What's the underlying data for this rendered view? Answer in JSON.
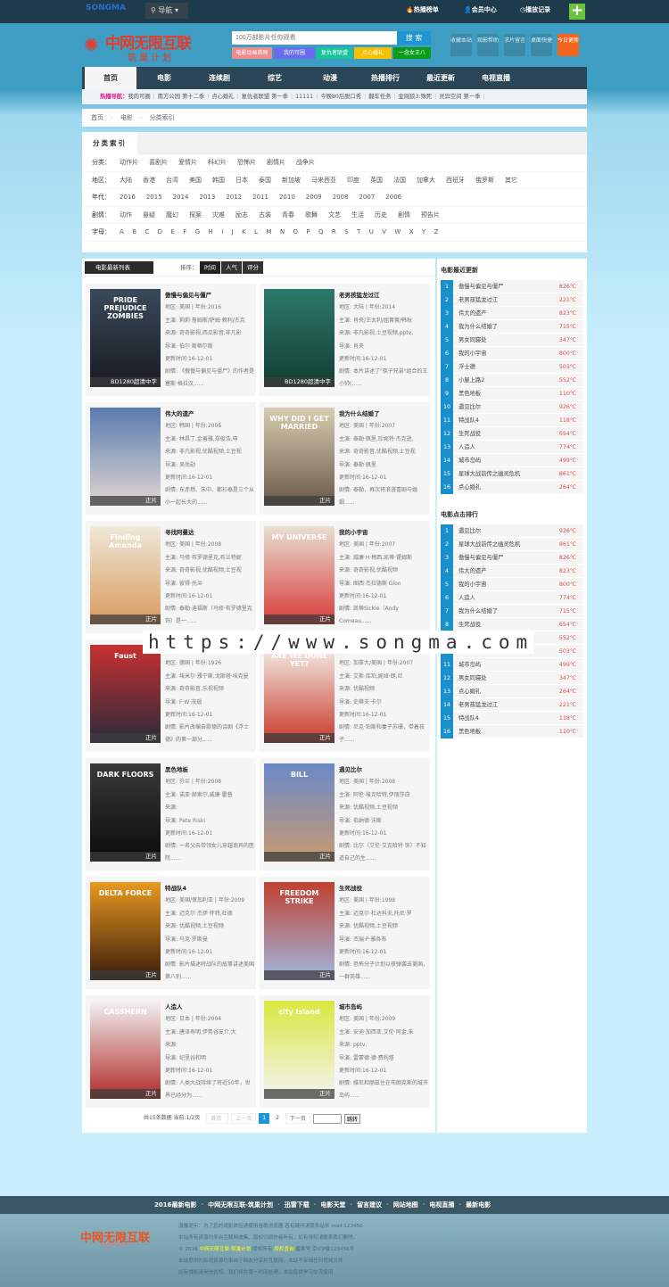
{
  "topbar": {
    "logo": "SONGMA",
    "nav": "导航",
    "links": [
      "热播榜单",
      "会员中心",
      "播放记录"
    ],
    "plus": "+"
  },
  "header": {
    "logo": "中网无限互联",
    "slogan": "筑巢计划",
    "search_placeholder": "100万部影片任你观看",
    "search_button": "搜 索",
    "tags": [
      {
        "label": "电影动画首映",
        "color": "#f08c8c"
      },
      {
        "label": "我的可圈",
        "color": "#6a6af0"
      },
      {
        "label": "复仇者联盟",
        "color": "#17c39a"
      },
      {
        "label": "点心婚礼",
        "color": "#f5c000"
      },
      {
        "label": "一念女王八",
        "color": "#0a9c1a"
      }
    ],
    "quick": [
      "收藏本站",
      "观影帮助",
      "求片留言",
      "桌面快捷",
      "今日更新"
    ]
  },
  "nav": {
    "items": [
      "首页",
      "电影",
      "连续剧",
      "综艺",
      "动漫",
      "热播排行",
      "最近更新",
      "电视直播"
    ],
    "active": 0
  },
  "hotnav": {
    "label": "热播导航：",
    "items": [
      "我的可圈",
      "南方公园 第十二季",
      "点心婚礼",
      "复仇者联盟 第一季",
      "11111",
      "今晚80后脱口秀",
      "翻车任务",
      "金刚狼3:殊死",
      "灵异空间 第一季"
    ]
  },
  "breadcrumb": [
    "首页",
    "电影",
    "分类索引"
  ],
  "filter": {
    "title": "分类索引",
    "rows": [
      {
        "label": "分类：",
        "items": [
          "动作片",
          "喜剧片",
          "爱情片",
          "科幻片",
          "恐怖片",
          "剧情片",
          "战争片"
        ]
      },
      {
        "label": "地区：",
        "items": [
          "大陆",
          "香港",
          "台湾",
          "美国",
          "韩国",
          "日本",
          "泰国",
          "新加坡",
          "马来西亚",
          "印度",
          "英国",
          "法国",
          "加拿大",
          "西班牙",
          "俄罗斯",
          "其它"
        ]
      },
      {
        "label": "年代：",
        "items": [
          "2016",
          "2015",
          "2014",
          "2013",
          "2012",
          "2011",
          "2010",
          "2009",
          "2008",
          "2007",
          "2006"
        ]
      },
      {
        "label": "剧情：",
        "items": [
          "动作",
          "悬疑",
          "魔幻",
          "探案",
          "灾难",
          "励志",
          "古装",
          "青春",
          "歌舞",
          "文艺",
          "生活",
          "历史",
          "剧情",
          "预告片"
        ]
      },
      {
        "label": "字母：",
        "items": [
          "A",
          "B",
          "C",
          "D",
          "E",
          "F",
          "G",
          "H",
          "I",
          "J",
          "K",
          "L",
          "M",
          "N",
          "O",
          "P",
          "Q",
          "R",
          "S",
          "T",
          "U",
          "V",
          "W",
          "X",
          "Y",
          "Z"
        ]
      }
    ]
  },
  "list": {
    "title": "电影最新列表",
    "sort_label": "排序：",
    "sorts": [
      "时间",
      "人气",
      "评分"
    ],
    "labels": {
      "region": "地区: ",
      "year": "年份:",
      "actors": "主演: ",
      "source": "来源: ",
      "director": "导演: ",
      "updated": "更新时间:",
      "desc": "剧情: "
    },
    "movies": [
      {
        "title": "傲慢与偏见与僵尸",
        "region": "美国",
        "year": "2016",
        "actors": "莉莉·詹姆斯/萨姆·赖利/杰克",
        "source": "奇奇影视,西瓜影音,非凡影",
        "director": "伯尔·斯蒂尔斯",
        "updated": "16-12-01",
        "desc": "《傲慢与偏见与僵尸》的作者是塞斯·格拉汉......",
        "badge": "BD1280超清中字",
        "poster": "PRIDE PREJUDICE ZOMBIES",
        "c1": "#3a4a5a",
        "c2": "#1a1a22"
      },
      {
        "title": "老男孩猛龙过江",
        "region": "大陆",
        "year": "2014",
        "actors": "肖央/王太利/屈菁菁/韩秋",
        "source": "非凡影视,土豆视频,pptv,",
        "director": "肖央",
        "updated": "16-12-01",
        "desc": "本片讲述了\"筷子兄弟\"组合的王小帅(......",
        "badge": "BD1280超清中字",
        "poster": "",
        "c1": "#2b7a6a",
        "c2": "#143c30"
      },
      {
        "title": "伟大的遗产",
        "region": "韩国",
        "year": "2006",
        "actors": "林昌丁,金善雅,郑俊浩,申",
        "source": "非凡影视,优酷视频,土豆视",
        "director": "吴尚勋",
        "updated": "16-12-01",
        "desc": "东赤燃、朱中、都衫泰是三个从小一起长大的......",
        "badge": "正片",
        "poster": "",
        "c1": "#5a7ab0",
        "c2": "#e0d8d0"
      },
      {
        "title": "我为什么结婚了",
        "region": "美国",
        "year": "2007",
        "actors": "泰勒·佩里,珍妮特·杰克逊,",
        "source": "奇奇影音,优酷视频,土豆视",
        "director": "泰勒·佩里",
        "updated": "16-12-01",
        "desc": "泰勒，再次将浪漫喜剧与婚姻......",
        "badge": "正片",
        "poster": "WHY DID I GET MARRIED",
        "c1": "#d8ccb0",
        "c2": "#6a5a48"
      },
      {
        "title": "寻找阿曼达",
        "region": "美国",
        "year": "2008",
        "actors": "马修·布罗德里克,布兰特妮",
        "source": "奇奇影视,优酷视频,土豆视",
        "director": "彼得·托兰",
        "updated": "16-12-01",
        "desc": "泰勒·迪福斯（马修·布罗德里克 饰）是一......",
        "badge": "正片",
        "poster": "Finding Amanda",
        "c1": "#f0e8d8",
        "c2": "#d89a60"
      },
      {
        "title": "我的小宇宙",
        "region": "美国",
        "year": "2007",
        "actors": "威廉·H·梅西,凯蒂·霍姆斯",
        "source": "奇奇影视,优酷视频",
        "director": "图西·杰拉德斯 Glon",
        "updated": "16-12-01",
        "desc": "凯蒂Sickie（Andy Comeau......",
        "badge": "正片",
        "poster": "MY UNIVERSE",
        "c1": "#e8e0d0",
        "c2": "#d83a3a"
      },
      {
        "title": "浮士德",
        "region": "德国",
        "year": "1926",
        "actors": "埃米尔·雅宁斯,戈斯塔·埃克曼",
        "source": "奇奇影音,乐视视频",
        "director": "F·W·茂瑙",
        "updated": "16-12-01",
        "desc": "影片改编自歌德的诗剧《浮士德》的第一部分......",
        "badge": "正片",
        "poster": "Faust",
        "c1": "#c83030",
        "c2": "#2a2a3a"
      },
      {
        "title": "小屋上路2",
        "region": "加拿大/美国",
        "year": "2007",
        "actors": "艾斯·库珀,妮娅·朗,尼",
        "source": "优酷视频",
        "director": "史蒂夫·卡尔",
        "updated": "16-12-01",
        "desc": "尼克·珀斯和妻子苏珊，带着孩子......",
        "badge": "正片",
        "poster": "ARE WE DONE YET?",
        "c1": "#f4f0ea",
        "c2": "#c83a2a"
      },
      {
        "title": "黑色地板",
        "region": "芬兰",
        "year": "2008",
        "actors": "诺亚·赫索尔,威廉·霍普",
        "source": "",
        "director": "Pete Riski",
        "updated": "16-12-01",
        "desc": "一名父亲带领女儿穿越诡异的医院......",
        "badge": "正片",
        "poster": "DARK FLOORS",
        "c1": "#3a3a3a",
        "c2": "#0a0a0a"
      },
      {
        "title": "遇见比尔",
        "region": "美国",
        "year": "2008",
        "actors": "阿伦·埃克哈特,伊丽莎白",
        "source": "优酷视频,土豆视频",
        "director": "伯纳德·沃斯",
        "updated": "16-12-01",
        "desc": "比尔（艾伦·艾克哈特 饰）不知道自己的生......",
        "badge": "正片",
        "poster": "BILL",
        "c1": "#6a8ac8",
        "c2": "#c89a70"
      },
      {
        "title": "特战队4",
        "region": "美国/保加利亚",
        "year": "2009",
        "actors": "迈克尔·杰伊·怀特,杜德",
        "source": "优酷视频,土豆视频",
        "director": "马克·罗斯曼",
        "updated": "16-12-01",
        "desc": "影片描述特战队的故事讲述美国第八别......",
        "badge": "正片",
        "poster": "DELTA FORCE",
        "c1": "#e89a20",
        "c2": "#3a1a0a"
      },
      {
        "title": "生死战役",
        "region": "美国",
        "year": "1998",
        "actors": "迈克尔·杜达科夫,托尼·罗",
        "source": "优酷视频,土豆视频",
        "director": "杰瑞·P·雅各布",
        "updated": "16-12-01",
        "desc": "恐怖分子计划以核弹袭击美国，一群英雄......",
        "badge": "正片",
        "poster": "FREEDOM STRIKE",
        "c1": "#c04030",
        "c2": "#a0b8e0"
      },
      {
        "title": "人造人",
        "region": "日本",
        "year": "2004",
        "actors": "唐泽寿明,伊势谷友介,大",
        "source": "",
        "director": "纪里谷和明",
        "updated": "16-12-01",
        "desc": "人类大战持续了将近50年，世界已经分为......",
        "badge": "正片",
        "poster": "CASSHERN",
        "c1": "#f2f2f2",
        "c2": "#b02a2a"
      },
      {
        "title": "城市岛屿",
        "region": "美国",
        "year": "2009",
        "actors": "安迪·加西亚,艾伦·阿金,朱",
        "source": "pptv,",
        "director": "雷蒙德·德·费利塔",
        "updated": "16-12-01",
        "desc": "维尼和丽兹住在布朗克斯的城市岛屿......",
        "badge": "正片",
        "poster": "city island",
        "c1": "#d8e840",
        "c2": "#f4f4f4"
      }
    ]
  },
  "pager": {
    "summary": "共15条数据 当前:1/2页",
    "first": "首页",
    "prev": "上一页",
    "pages": [
      "1",
      "2"
    ],
    "current": "1",
    "next": "下一页",
    "last": "尾页",
    "go": "跳转"
  },
  "sidebar": {
    "latest_title": "电影最近更新",
    "latest": [
      [
        "傲慢与偏见与僵尸",
        "826℃"
      ],
      [
        "老男孩猛龙过江",
        "221℃"
      ],
      [
        "伟大的遗产",
        "823℃"
      ],
      [
        "我为什么结婚了",
        "715℃"
      ],
      [
        "男女同寝处",
        "347℃"
      ],
      [
        "我的小宇宙",
        "800℃"
      ],
      [
        "浮士德",
        "503℃"
      ],
      [
        "小屋上路2",
        "552℃"
      ],
      [
        "黑色地板",
        "110℃"
      ],
      [
        "遇见比尔",
        "926℃"
      ],
      [
        "特战队4",
        "118℃"
      ],
      [
        "生死战役",
        "654℃"
      ],
      [
        "人造人",
        "774℃"
      ],
      [
        "城市岛屿",
        "499℃"
      ],
      [
        "星球大战前传之幽灵危机",
        "861℃"
      ],
      [
        "点心婚礼",
        "264℃"
      ]
    ],
    "rank_title": "电影点击排行",
    "rank": [
      [
        "遇见比尔",
        "926℃"
      ],
      [
        "星球大战前传之幽灵危机",
        "861℃"
      ],
      [
        "傲慢与偏见与僵尸",
        "826℃"
      ],
      [
        "伟大的遗产",
        "823℃"
      ],
      [
        "我的小宇宙",
        "800℃"
      ],
      [
        "人造人",
        "774℃"
      ],
      [
        "我为什么结婚了",
        "715℃"
      ],
      [
        "生死战役",
        "654℃"
      ],
      [
        "小屋上路2",
        "552℃"
      ],
      [
        "浮士德",
        "503℃"
      ],
      [
        "城市岛屿",
        "499℃"
      ],
      [
        "男女同寝处",
        "347℃"
      ],
      [
        "点心婚礼",
        "264℃"
      ],
      [
        "老男孩猛龙过江",
        "221℃"
      ],
      [
        "特战队4",
        "118℃"
      ],
      [
        "黑色地板",
        "110℃"
      ]
    ]
  },
  "watermark": "https://www.songma.com",
  "footer": {
    "nav": [
      "2016最新电影",
      "中网无限互联-筑巢计划",
      "迅雷下载",
      "电影天堂",
      "留言建议",
      "网站地图",
      "电视直播",
      "最新电影"
    ],
    "logo": "中网无限互联",
    "slogan": "筑巢计划",
    "lines": [
      "温馨提示：为了您的观影体验请使用谷歌浏览器 若有疑问请联系站长 mail:123456",
      "本站所有资源均来自互联网收集，版权归原作者所有，如有侵权请联系我们删除。",
      "© 2016 ",
      "中网无限互联-筑巢计划",
      " 版权所有 ",
      "授权查询",
      " 备案号:京ICP备123456号",
      "本站提供的影视资源均来自于网友分享和互联网，本站不存储任何视频文件",
      "如有侵权请来信告知，我们将在第一时间处理，本站仅供学习交流使用"
    ]
  }
}
